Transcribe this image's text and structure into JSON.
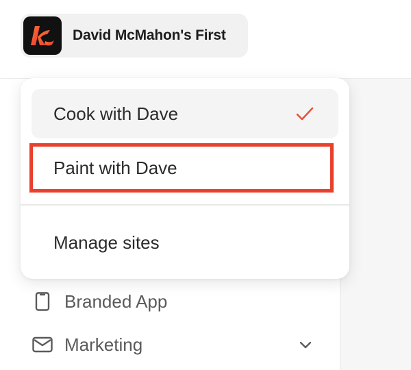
{
  "header": {
    "site_name": "David McMahon's First",
    "logo_icon": "k-logo-icon",
    "logo_bg": "#111111",
    "logo_accent": "#f0522f"
  },
  "dropdown": {
    "items": [
      {
        "label": "Cook with Dave",
        "selected": true
      },
      {
        "label": "Paint with Dave",
        "selected": false,
        "highlighted": true
      },
      {
        "label": "Manage sites"
      }
    ],
    "check_color": "#e8533a",
    "highlight_color": "#e8402c"
  },
  "sidebar": {
    "items": [
      {
        "label": "Branded App",
        "icon": "phone-icon"
      },
      {
        "label": "Marketing",
        "icon": "mail-icon",
        "expandable": true
      }
    ]
  }
}
